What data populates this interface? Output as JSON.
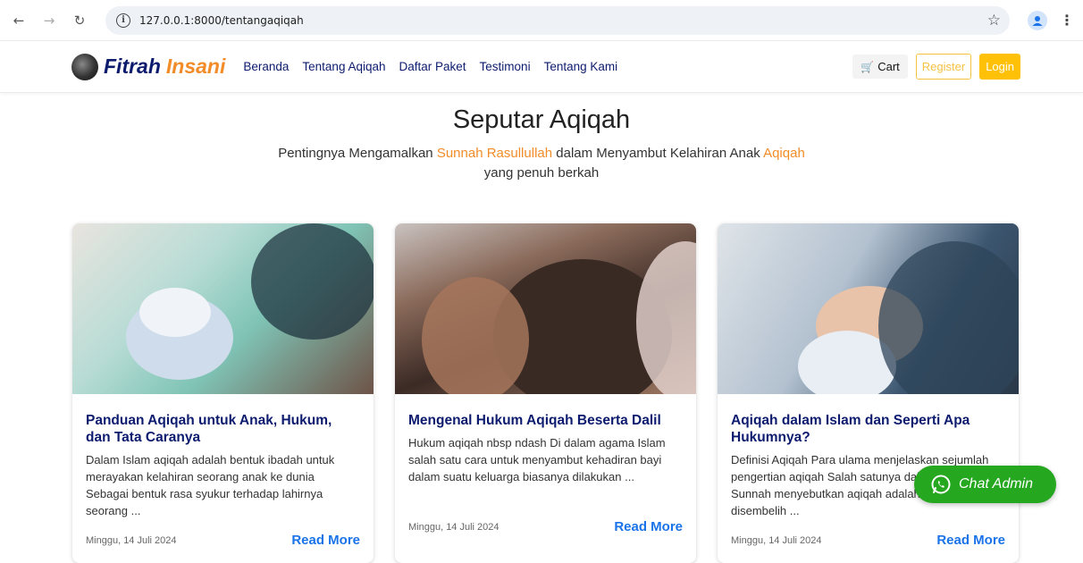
{
  "browser": {
    "url": "127.0.0.1:8000/tentangaqiqah"
  },
  "site": {
    "logo_part1": "Fitrah",
    "logo_part2": "Insani",
    "menu": [
      "Beranda",
      "Tentang Aqiqah",
      "Daftar Paket",
      "Testimoni",
      "Tentang Kami"
    ],
    "cart_label": "Cart",
    "register_label": "Register",
    "login_label": "Login"
  },
  "hero": {
    "title": "Seputar Aqiqah",
    "sub_part1": "Pentingnya Mengamalkan ",
    "sub_highlight1": "Sunnah Rasullullah",
    "sub_part2": " dalam Menyambut Kelahiran Anak ",
    "sub_highlight2": "Aqiqah",
    "sub_line2": "yang penuh berkah"
  },
  "articles": [
    {
      "title": "Panduan Aqiqah untuk Anak, Hukum, dan Tata Caranya",
      "desc": "Dalam Islam aqiqah adalah bentuk ibadah untuk merayakan kelahiran seorang anak ke dunia Sebagai bentuk rasa syukur terhadap lahirnya seorang ...",
      "date": "Minggu, 14 Juli 2024",
      "read_more": "Read More"
    },
    {
      "title": "Mengenal Hukum Aqiqah Beserta Dalil",
      "desc": "Hukum aqiqah nbsp ndash Di dalam agama Islam salah satu cara untuk menyambut kehadiran bayi dalam suatu keluarga biasanya dilakukan ...",
      "date": "Minggu, 14 Juli 2024",
      "read_more": "Read More"
    },
    {
      "title": "Aqiqah dalam Islam dan Seperti Apa Hukumnya?",
      "desc": "Definisi Aqiqah Para ulama menjelaskan sejumlah pengertian aqiqah Salah satunya dalam buku Fiqih Sunnah menyebutkan aqiqah adalah binatang yang disembelih ...",
      "date": "Minggu, 14 Juli 2024",
      "read_more": "Read More"
    }
  ],
  "chat": {
    "label": "Chat Admin"
  }
}
